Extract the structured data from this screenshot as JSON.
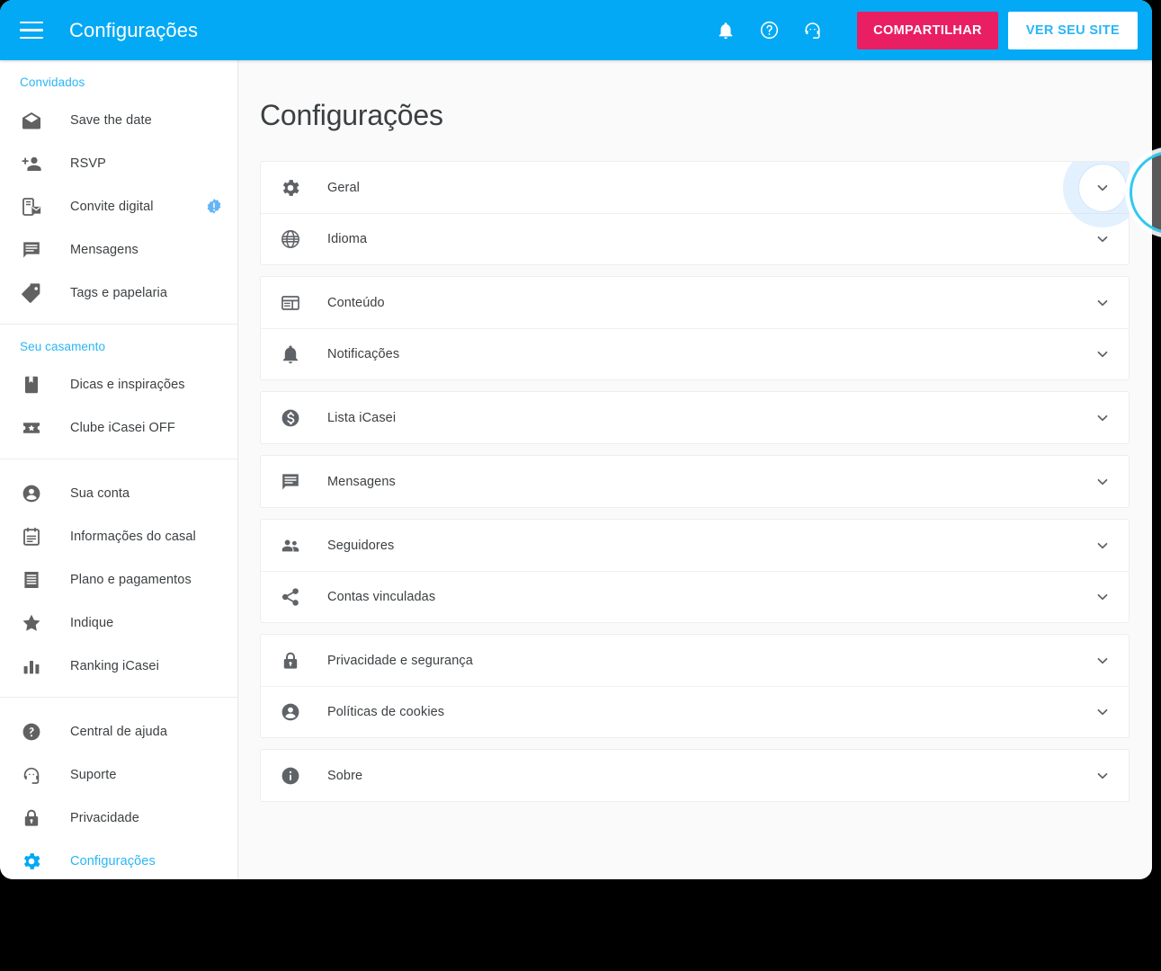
{
  "topbar": {
    "menu_icon": "hamburger-menu-icon",
    "title": "Configurações",
    "icons": [
      {
        "name": "notifications-bell-icon",
        "label": "Notificações"
      },
      {
        "name": "help-circle-icon",
        "label": "Ajuda"
      },
      {
        "name": "support-headset-icon",
        "label": "Suporte"
      }
    ],
    "share_label": "COMPARTILHAR",
    "view_site_label": "VER SEU SITE",
    "bg_color": "#03a9f4",
    "share_color": "#e91e63",
    "view_site_text_color": "#29b6f6"
  },
  "sidebar": {
    "groups": [
      {
        "title": "Convidados",
        "items": [
          {
            "label": "Save the date",
            "icon": "mail-open-icon",
            "badge": false,
            "active": false
          },
          {
            "label": "RSVP",
            "icon": "person-add-icon",
            "badge": false,
            "active": false
          },
          {
            "label": "Convite digital",
            "icon": "mobile-invite-icon",
            "badge": true,
            "active": false
          },
          {
            "label": "Mensagens",
            "icon": "message-icon",
            "badge": false,
            "active": false
          },
          {
            "label": "Tags e papelaria",
            "icon": "tag-icon",
            "badge": false,
            "active": false
          }
        ]
      },
      {
        "title": "Seu casamento",
        "items": [
          {
            "label": "Dicas e inspirações",
            "icon": "book-icon",
            "badge": false,
            "active": false
          },
          {
            "label": "Clube iCasei OFF",
            "icon": "ticket-star-icon",
            "badge": false,
            "active": false
          }
        ]
      },
      {
        "title": "",
        "items": [
          {
            "label": "Sua conta",
            "icon": "account-circle-icon",
            "badge": false,
            "active": false
          },
          {
            "label": "Informações do casal",
            "icon": "note-list-icon",
            "badge": false,
            "active": false
          },
          {
            "label": "Plano e pagamentos",
            "icon": "receipt-icon",
            "badge": false,
            "active": false
          },
          {
            "label": "Indique",
            "icon": "star-icon",
            "badge": false,
            "active": false
          },
          {
            "label": "Ranking iCasei",
            "icon": "bar-chart-icon",
            "badge": false,
            "active": false
          }
        ]
      },
      {
        "title": "",
        "items": [
          {
            "label": "Central de ajuda",
            "icon": "help-circle-icon",
            "badge": false,
            "active": false
          },
          {
            "label": "Suporte",
            "icon": "support-headset-icon",
            "badge": false,
            "active": false
          },
          {
            "label": "Privacidade",
            "icon": "lock-icon",
            "badge": false,
            "active": false
          },
          {
            "label": "Configurações",
            "icon": "gear-icon",
            "badge": false,
            "active": true
          }
        ]
      }
    ],
    "group_title_color": "#29b6f6",
    "active_color": "#29b6f6"
  },
  "main": {
    "page_title": "Configurações",
    "cards": [
      {
        "rows": [
          {
            "label": "Geral",
            "icon": "gear-icon",
            "focused": true
          },
          {
            "label": "Idioma",
            "icon": "globe-icon",
            "focused": false
          }
        ]
      },
      {
        "rows": [
          {
            "label": "Conteúdo",
            "icon": "layout-icon",
            "focused": false
          },
          {
            "label": "Notificações",
            "icon": "bell-icon",
            "focused": false
          }
        ]
      },
      {
        "rows": [
          {
            "label": "Lista iCasei",
            "icon": "money-circle-icon",
            "focused": false
          }
        ]
      },
      {
        "rows": [
          {
            "label": "Mensagens",
            "icon": "message-icon",
            "focused": false
          }
        ]
      },
      {
        "rows": [
          {
            "label": "Seguidores",
            "icon": "people-icon",
            "focused": false
          },
          {
            "label": "Contas vinculadas",
            "icon": "share-icon",
            "focused": false
          }
        ]
      },
      {
        "rows": [
          {
            "label": "Privacidade e segurança",
            "icon": "lock-icon",
            "focused": false
          },
          {
            "label": "Políticas de cookies",
            "icon": "account-circle-icon",
            "focused": false
          }
        ]
      },
      {
        "rows": [
          {
            "label": "Sobre",
            "icon": "info-circle-icon",
            "focused": false
          }
        ]
      }
    ],
    "chevron_icon": "chevron-down-icon"
  }
}
